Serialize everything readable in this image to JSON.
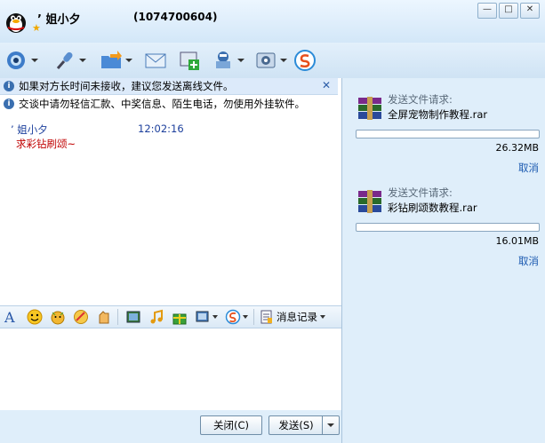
{
  "window": {
    "contact_name": "’ 姐小夕",
    "contact_id": "(1074700604)",
    "minimize": "—",
    "maximize": "□",
    "close": "✕"
  },
  "toolbar": {
    "icons": [
      "video-call-icon",
      "voice-call-icon",
      "send-file-icon",
      "mail-icon",
      "app-add-icon",
      "remote-assist-icon",
      "settings-icon",
      "soso-icon"
    ]
  },
  "notice": {
    "offline_tip": "如果对方长时间未接收，建议您发送离线文件。",
    "close": "✕",
    "security_tip": "交谈中请勿轻信汇款、中奖信息、陌生电话，勿使用外挂软件。"
  },
  "chat": {
    "sender": "’  姐小夕",
    "time": "12:02:16",
    "message": "求彩钻刷颂~"
  },
  "format_bar": {
    "message_log": "消息记录"
  },
  "buttons": {
    "close": "关闭(C)",
    "send": "发送(S)"
  },
  "transfers": [
    {
      "header": "发送文件请求:",
      "filename": "全屏宠物制作教程.rar",
      "size": "26.32MB",
      "cancel": "取消",
      "progress": 0
    },
    {
      "header": "发送文件请求:",
      "filename": "彩钻刷颂数教程.rar",
      "size": "16.01MB",
      "cancel": "取消",
      "progress": 0
    }
  ]
}
